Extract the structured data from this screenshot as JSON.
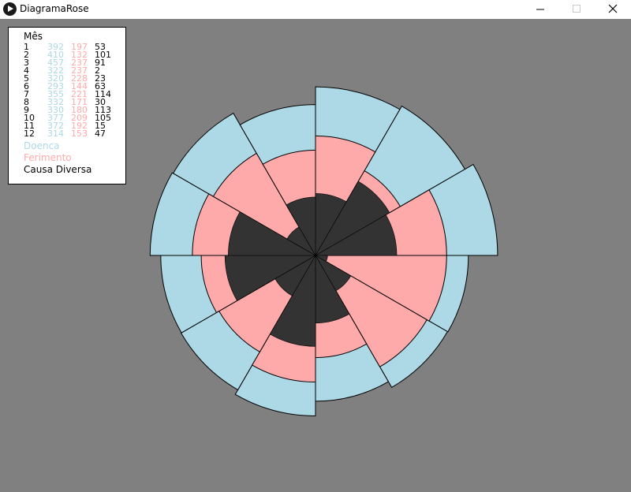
{
  "window": {
    "title": "DiagramaRose"
  },
  "legend": {
    "title": "Mês",
    "rows": [
      {
        "mes": "1",
        "doenca": "392",
        "ferimento": "197",
        "causa": "53"
      },
      {
        "mes": "2",
        "doenca": "410",
        "ferimento": "132",
        "causa": "101"
      },
      {
        "mes": "3",
        "doenca": "457",
        "ferimento": "237",
        "causa": "91"
      },
      {
        "mes": "4",
        "doenca": "322",
        "ferimento": "237",
        "causa": "2"
      },
      {
        "mes": "5",
        "doenca": "320",
        "ferimento": "228",
        "causa": "23"
      },
      {
        "mes": "6",
        "doenca": "293",
        "ferimento": "144",
        "causa": "63"
      },
      {
        "mes": "7",
        "doenca": "355",
        "ferimento": "221",
        "causa": "114"
      },
      {
        "mes": "8",
        "doenca": "332",
        "ferimento": "171",
        "causa": "30"
      },
      {
        "mes": "9",
        "doenca": "330",
        "ferimento": "180",
        "causa": "113"
      },
      {
        "mes": "10",
        "doenca": "377",
        "ferimento": "209",
        "causa": "105"
      },
      {
        "mes": "11",
        "doenca": "372",
        "ferimento": "192",
        "causa": "15"
      },
      {
        "mes": "12",
        "doenca": "314",
        "ferimento": "153",
        "causa": "47"
      }
    ],
    "names": [
      "Doenca",
      "Ferimento",
      "Causa Diversa"
    ]
  },
  "colors": {
    "doenca": "#add8e6",
    "ferimento": "#ffaaaa",
    "causa": "#333333",
    "background": "#808080"
  },
  "chart_data": {
    "type": "rose",
    "categories": [
      "1",
      "2",
      "3",
      "4",
      "5",
      "6",
      "7",
      "8",
      "9",
      "10",
      "11",
      "12"
    ],
    "series": [
      {
        "name": "Doenca",
        "values": [
          392,
          410,
          457,
          322,
          320,
          293,
          355,
          332,
          330,
          377,
          372,
          314
        ]
      },
      {
        "name": "Ferimento",
        "values": [
          197,
          132,
          237,
          237,
          228,
          144,
          221,
          171,
          180,
          209,
          192,
          153
        ]
      },
      {
        "name": "Causa Diversa",
        "values": [
          53,
          101,
          91,
          2,
          23,
          63,
          114,
          30,
          113,
          105,
          15,
          47
        ]
      }
    ]
  }
}
